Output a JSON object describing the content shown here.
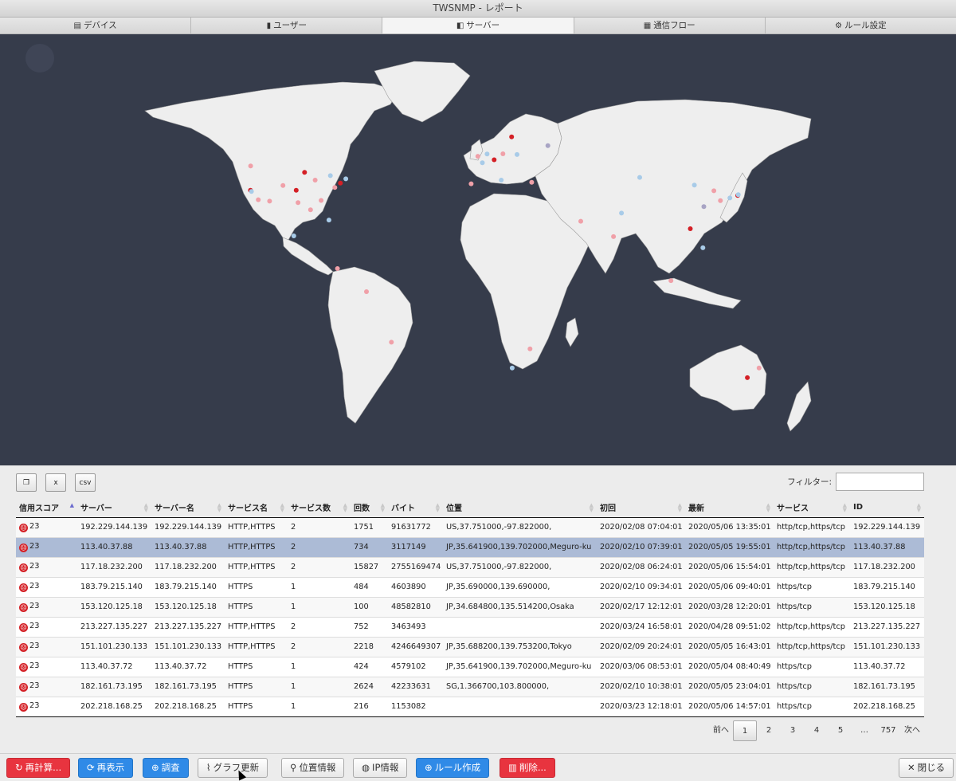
{
  "window": {
    "title": "TWSNMP - レポート"
  },
  "tabs": [
    {
      "label": "デバイス",
      "icon": "server-icon",
      "active": false
    },
    {
      "label": "ユーザー",
      "icon": "clipboard-icon",
      "active": false
    },
    {
      "label": "サーバー",
      "icon": "server-square-icon",
      "active": true
    },
    {
      "label": "通信フロー",
      "icon": "flow-icon",
      "active": false
    },
    {
      "label": "ルール設定",
      "icon": "gear-icon",
      "active": false
    }
  ],
  "toolbar": {
    "copy_icon": "copy-icon",
    "excel_icon": "excel-icon",
    "csv_icon": "csv-icon"
  },
  "filter": {
    "label": "フィルター:",
    "value": ""
  },
  "table": {
    "columns": [
      "信用スコア",
      "サーバー",
      "サーバー名",
      "サービス名",
      "サービス数",
      "回数",
      "バイト",
      "位置",
      "初回",
      "最新",
      "サービス",
      "ID"
    ],
    "sorted_column": "信用スコア",
    "rows": [
      [
        "23",
        "192.229.144.139",
        "192.229.144.139",
        "HTTP,HTTPS",
        "2",
        "1751",
        "91631772",
        "US,37.751000,-97.822000,",
        "2020/02/08 07:04:01",
        "2020/05/06 13:35:01",
        "http/tcp,https/tcp",
        "192.229.144.139"
      ],
      [
        "23",
        "113.40.37.88",
        "113.40.37.88",
        "HTTP,HTTPS",
        "2",
        "734",
        "3117149",
        "JP,35.641900,139.702000,Meguro-ku",
        "2020/02/10 07:39:01",
        "2020/05/05 19:55:01",
        "http/tcp,https/tcp",
        "113.40.37.88"
      ],
      [
        "23",
        "117.18.232.200",
        "117.18.232.200",
        "HTTP,HTTPS",
        "2",
        "15827",
        "2755169474",
        "US,37.751000,-97.822000,",
        "2020/02/08 06:24:01",
        "2020/05/06 15:54:01",
        "http/tcp,https/tcp",
        "117.18.232.200"
      ],
      [
        "23",
        "183.79.215.140",
        "183.79.215.140",
        "HTTPS",
        "1",
        "484",
        "4603890",
        "JP,35.690000,139.690000,",
        "2020/02/10 09:34:01",
        "2020/05/06 09:40:01",
        "https/tcp",
        "183.79.215.140"
      ],
      [
        "23",
        "153.120.125.18",
        "153.120.125.18",
        "HTTPS",
        "1",
        "100",
        "48582810",
        "JP,34.684800,135.514200,Osaka",
        "2020/02/17 12:12:01",
        "2020/03/28 12:20:01",
        "https/tcp",
        "153.120.125.18"
      ],
      [
        "23",
        "213.227.135.227",
        "213.227.135.227",
        "HTTP,HTTPS",
        "2",
        "752",
        "3463493",
        "",
        "2020/03/24 16:58:01",
        "2020/04/28 09:51:02",
        "http/tcp,https/tcp",
        "213.227.135.227"
      ],
      [
        "23",
        "151.101.230.133",
        "151.101.230.133",
        "HTTP,HTTPS",
        "2",
        "2218",
        "4246649307",
        "JP,35.688200,139.753200,Tokyo",
        "2020/02/09 20:24:01",
        "2020/05/05 16:43:01",
        "http/tcp,https/tcp",
        "151.101.230.133"
      ],
      [
        "23",
        "113.40.37.72",
        "113.40.37.72",
        "HTTPS",
        "1",
        "424",
        "4579102",
        "JP,35.641900,139.702000,Meguro-ku",
        "2020/03/06 08:53:01",
        "2020/05/04 08:40:49",
        "https/tcp",
        "113.40.37.72"
      ],
      [
        "23",
        "182.161.73.195",
        "182.161.73.195",
        "HTTPS",
        "1",
        "2624",
        "42233631",
        "SG,1.366700,103.800000,",
        "2020/02/10 10:38:01",
        "2020/05/05 23:04:01",
        "https/tcp",
        "182.161.73.195"
      ],
      [
        "23",
        "202.218.168.25",
        "202.218.168.25",
        "HTTPS",
        "1",
        "216",
        "1153082",
        "",
        "2020/03/23 12:18:01",
        "2020/05/06 14:57:01",
        "https/tcp",
        "202.218.168.25"
      ]
    ],
    "selected_row": 1
  },
  "pager": {
    "prev": "前へ",
    "pages": [
      "1",
      "2",
      "3",
      "4",
      "5",
      "…",
      "757"
    ],
    "current": "1",
    "next": "次へ"
  },
  "buttons": {
    "recalc": "再計算...",
    "refresh": "再表示",
    "investigate": "調査",
    "graph": "グラフ更新",
    "location": "位置情報",
    "ipinfo": "IP情報",
    "rule": "ルール作成",
    "delete": "削除...",
    "close": "閉じる"
  },
  "colors": {
    "map_bg": "#363c4b",
    "land": "#eeeeee",
    "danger": "#e8343f",
    "primary": "#2f8ae7",
    "selected_row": "#acbbd6"
  },
  "map_markers": [
    {
      "lon": -122.4,
      "lat": 37.8,
      "c": "#d42026"
    },
    {
      "lon": -118.2,
      "lat": 34.0,
      "c": "#f0a0a8"
    },
    {
      "lon": -121.9,
      "lat": 37.3,
      "c": "#a8cbe8"
    },
    {
      "lon": -97.8,
      "lat": 37.8,
      "c": "#d42026"
    },
    {
      "lon": -87.6,
      "lat": 41.9,
      "c": "#f0a0a8"
    },
    {
      "lon": -74.0,
      "lat": 40.7,
      "c": "#d42026"
    },
    {
      "lon": -77.0,
      "lat": 38.9,
      "c": "#f0a0a8"
    },
    {
      "lon": -84.4,
      "lat": 33.7,
      "c": "#f0a0a8"
    },
    {
      "lon": -96.8,
      "lat": 32.8,
      "c": "#f0a0a8"
    },
    {
      "lon": -80.2,
      "lat": 25.8,
      "c": "#a8cbe8"
    },
    {
      "lon": -71.1,
      "lat": 42.4,
      "c": "#a8cbe8"
    },
    {
      "lon": -104.9,
      "lat": 39.7,
      "c": "#f0a0a8"
    },
    {
      "lon": -112.1,
      "lat": 33.4,
      "c": "#f0a0a8"
    },
    {
      "lon": -122.3,
      "lat": 47.6,
      "c": "#f0a0a8"
    },
    {
      "lon": -79.4,
      "lat": 43.7,
      "c": "#a8cbe8"
    },
    {
      "lon": -90.1,
      "lat": 29.9,
      "c": "#f0a0a8"
    },
    {
      "lon": -93.3,
      "lat": 45.0,
      "c": "#d42026"
    },
    {
      "lon": -99.1,
      "lat": 19.4,
      "c": "#a8cbe8"
    },
    {
      "lon": -75.6,
      "lat": 6.2,
      "c": "#f0a0a8"
    },
    {
      "lon": -60.0,
      "lat": -3.1,
      "c": "#f0a0a8"
    },
    {
      "lon": -0.1,
      "lat": 51.5,
      "c": "#f0a0a8"
    },
    {
      "lon": 2.35,
      "lat": 48.9,
      "c": "#a8cbe8"
    },
    {
      "lon": 8.7,
      "lat": 50.1,
      "c": "#d42026"
    },
    {
      "lon": 4.9,
      "lat": 52.4,
      "c": "#a8cbe8"
    },
    {
      "lon": 13.4,
      "lat": 52.5,
      "c": "#f0a0a8"
    },
    {
      "lon": 18.1,
      "lat": 59.3,
      "c": "#d42026"
    },
    {
      "lon": 12.5,
      "lat": 41.9,
      "c": "#a8cbe8"
    },
    {
      "lon": -3.7,
      "lat": 40.4,
      "c": "#f0a0a8"
    },
    {
      "lon": 21.0,
      "lat": 52.2,
      "c": "#a8cbe8"
    },
    {
      "lon": 37.6,
      "lat": 55.8,
      "c": "#a8a4c4"
    },
    {
      "lon": 28.9,
      "lat": 41.0,
      "c": "#f0a0a8"
    },
    {
      "lon": 55.3,
      "lat": 25.3,
      "c": "#f0a0a8"
    },
    {
      "lon": 72.9,
      "lat": 19.1,
      "c": "#f0a0a8"
    },
    {
      "lon": 77.2,
      "lat": 28.6,
      "c": "#a8cbe8"
    },
    {
      "lon": 103.8,
      "lat": 1.37,
      "c": "#f0a0a8"
    },
    {
      "lon": 116.4,
      "lat": 39.9,
      "c": "#a8cbe8"
    },
    {
      "lon": 121.5,
      "lat": 31.2,
      "c": "#a8a4c4"
    },
    {
      "lon": 114.2,
      "lat": 22.3,
      "c": "#d42026"
    },
    {
      "lon": 126.9,
      "lat": 37.6,
      "c": "#f0a0a8"
    },
    {
      "lon": 139.7,
      "lat": 35.7,
      "c": "#d42026"
    },
    {
      "lon": 135.5,
      "lat": 34.7,
      "c": "#a8cbe8"
    },
    {
      "lon": 140.0,
      "lat": 36.0,
      "c": "#a8cbe8"
    },
    {
      "lon": 121.0,
      "lat": 14.6,
      "c": "#a8cbe8"
    },
    {
      "lon": 151.2,
      "lat": -33.9,
      "c": "#f0a0a8"
    },
    {
      "lon": 144.9,
      "lat": -37.8,
      "c": "#d42026"
    },
    {
      "lon": 18.4,
      "lat": -33.9,
      "c": "#a8cbe8"
    },
    {
      "lon": 28.0,
      "lat": -26.2,
      "c": "#f0a0a8"
    },
    {
      "lon": -46.6,
      "lat": -23.5,
      "c": "#f0a0a8"
    },
    {
      "lon": 130.4,
      "lat": 33.6,
      "c": "#f0a0a8"
    },
    {
      "lon": 87.0,
      "lat": 43.0,
      "c": "#a8cbe8"
    }
  ]
}
